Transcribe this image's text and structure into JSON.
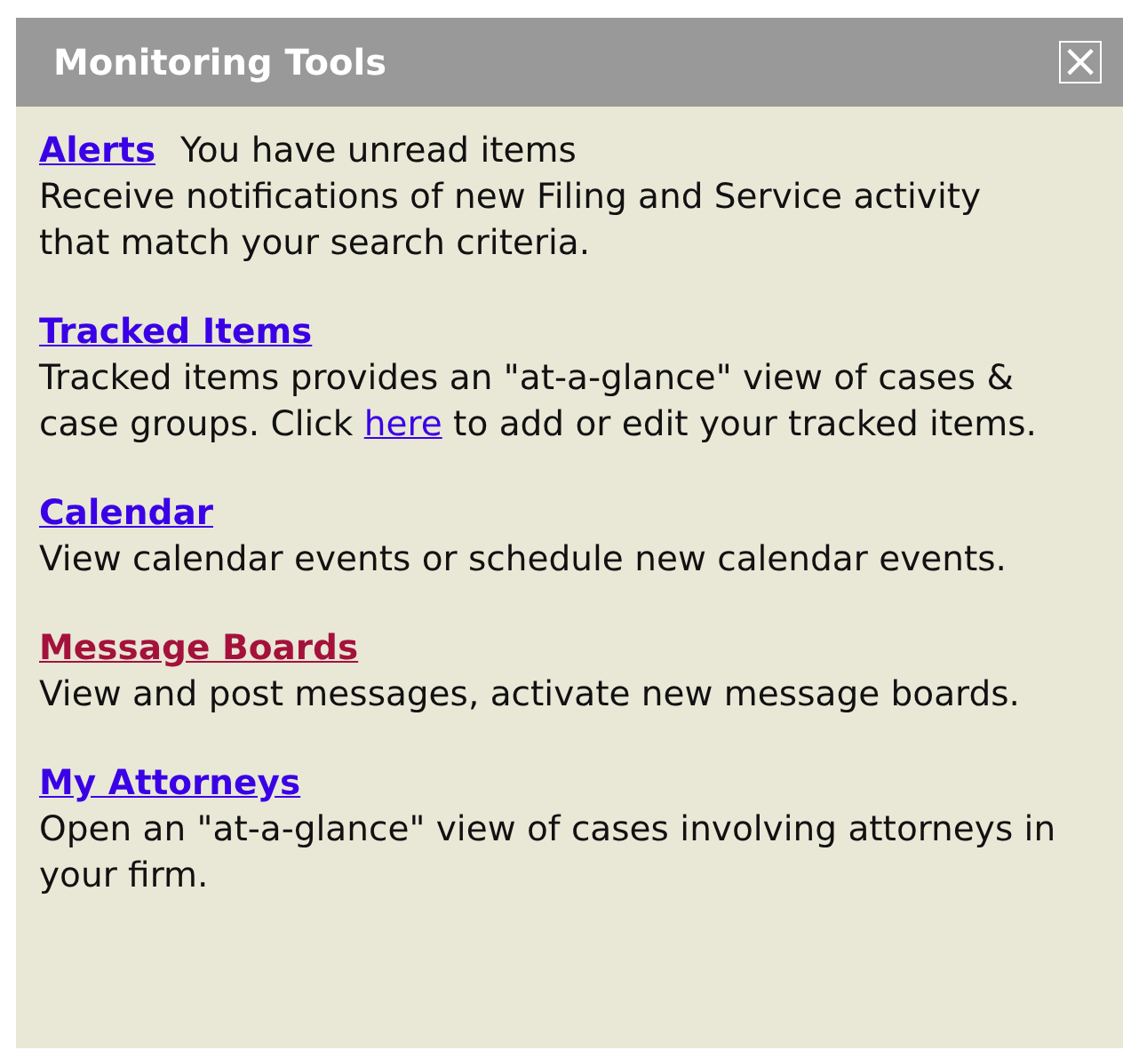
{
  "panel": {
    "title": "Monitoring Tools",
    "close": "×"
  },
  "sections": [
    {
      "title": "Alerts",
      "visited": false,
      "status": "You have unread items",
      "description": [
        {
          "kind": "text",
          "text": "Receive notifications of new Filing and Service activity that match your search criteria."
        }
      ]
    },
    {
      "title": "Tracked Items",
      "visited": false,
      "description": [
        {
          "kind": "text",
          "text": "Tracked items provides an \"at-a-glance\" view of cases & case groups. Click "
        },
        {
          "kind": "link",
          "text": "here"
        },
        {
          "kind": "text",
          "text": " to add or edit your tracked items."
        }
      ]
    },
    {
      "title": "Calendar",
      "visited": false,
      "description": [
        {
          "kind": "text",
          "text": "View calendar events or schedule new calendar events."
        }
      ]
    },
    {
      "title": "Message Boards",
      "visited": true,
      "description": [
        {
          "kind": "text",
          "text": "View and post messages, activate new message boards."
        }
      ]
    },
    {
      "title": "My Attorneys",
      "visited": false,
      "description": [
        {
          "kind": "text",
          "text": "Open an \"at-a-glance\" view of cases involving attorneys in your firm."
        }
      ]
    }
  ]
}
